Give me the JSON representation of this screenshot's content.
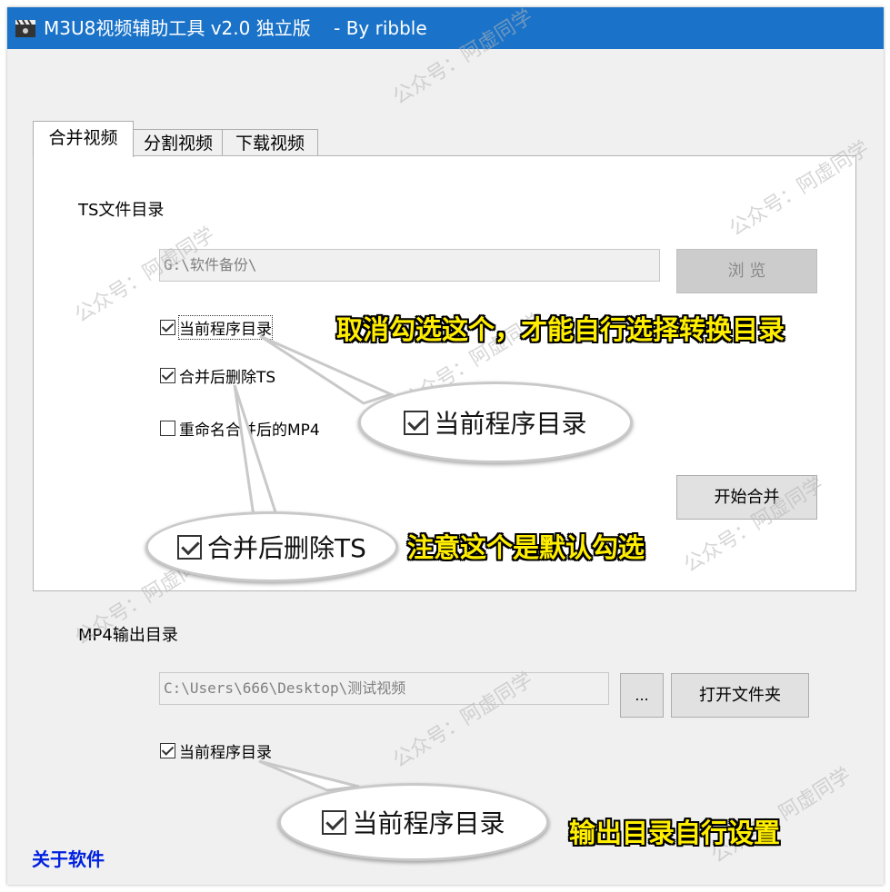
{
  "window": {
    "title": "M3U8视频辅助工具 v2.0 独立版    - By ribble"
  },
  "tabs": [
    "合并视频",
    "分割视频",
    "下载视频"
  ],
  "merge": {
    "ts_dir_label": "TS文件目录",
    "ts_dir_value": "G:\\软件备份\\",
    "browse_label": "浏 览",
    "cb_current_dir": "当前程序目录",
    "cb_delete_ts": "合并后删除TS",
    "cb_rename": "重命名合并后的MP4",
    "start_label": "开始合并"
  },
  "output": {
    "label": "MP4输出目录",
    "value": "C:\\Users\\666\\Desktop\\测试视频",
    "dots_label": "...",
    "open_folder_label": "打开文件夹",
    "cb_current_dir": "当前程序目录"
  },
  "about_link": "关于软件",
  "annotations": {
    "bubble1": "当前程序目录",
    "note1": "取消勾选这个，才能自行选择转换目录",
    "bubble2": "合并后删除TS",
    "note2": "注意这个是默认勾选",
    "bubble3": "当前程序目录",
    "note3": "输出目录自行设置"
  },
  "watermark": "公众号：阿虚同学",
  "colors": {
    "titlebar": "#1a73c9",
    "note": "#ffee00",
    "about_link": "#0020e0"
  }
}
